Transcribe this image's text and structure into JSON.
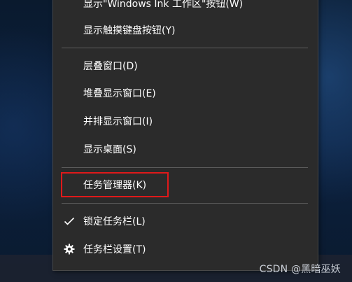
{
  "context_menu": {
    "items": [
      {
        "label": "显示\"Windows Ink 工作区\"按钮(W)"
      },
      {
        "label": "显示触摸键盘按钮(Y)"
      },
      {
        "label": "层叠窗口(D)"
      },
      {
        "label": "堆叠显示窗口(E)"
      },
      {
        "label": "并排显示窗口(I)"
      },
      {
        "label": "显示桌面(S)"
      },
      {
        "label": "任务管理器(K)"
      },
      {
        "label": "锁定任务栏(L)",
        "checked": true,
        "icon": "checkmark-icon"
      },
      {
        "label": "任务栏设置(T)",
        "icon": "gear-icon"
      }
    ],
    "highlighted_item": "任务管理器(K)",
    "highlight_color": "#e0191a"
  },
  "watermark": {
    "text": "CSDN @黑暗巫妖"
  },
  "colors": {
    "menu_background": "#2b2b2b",
    "menu_text": "#ffffff",
    "separator": "#5c5c5c"
  }
}
